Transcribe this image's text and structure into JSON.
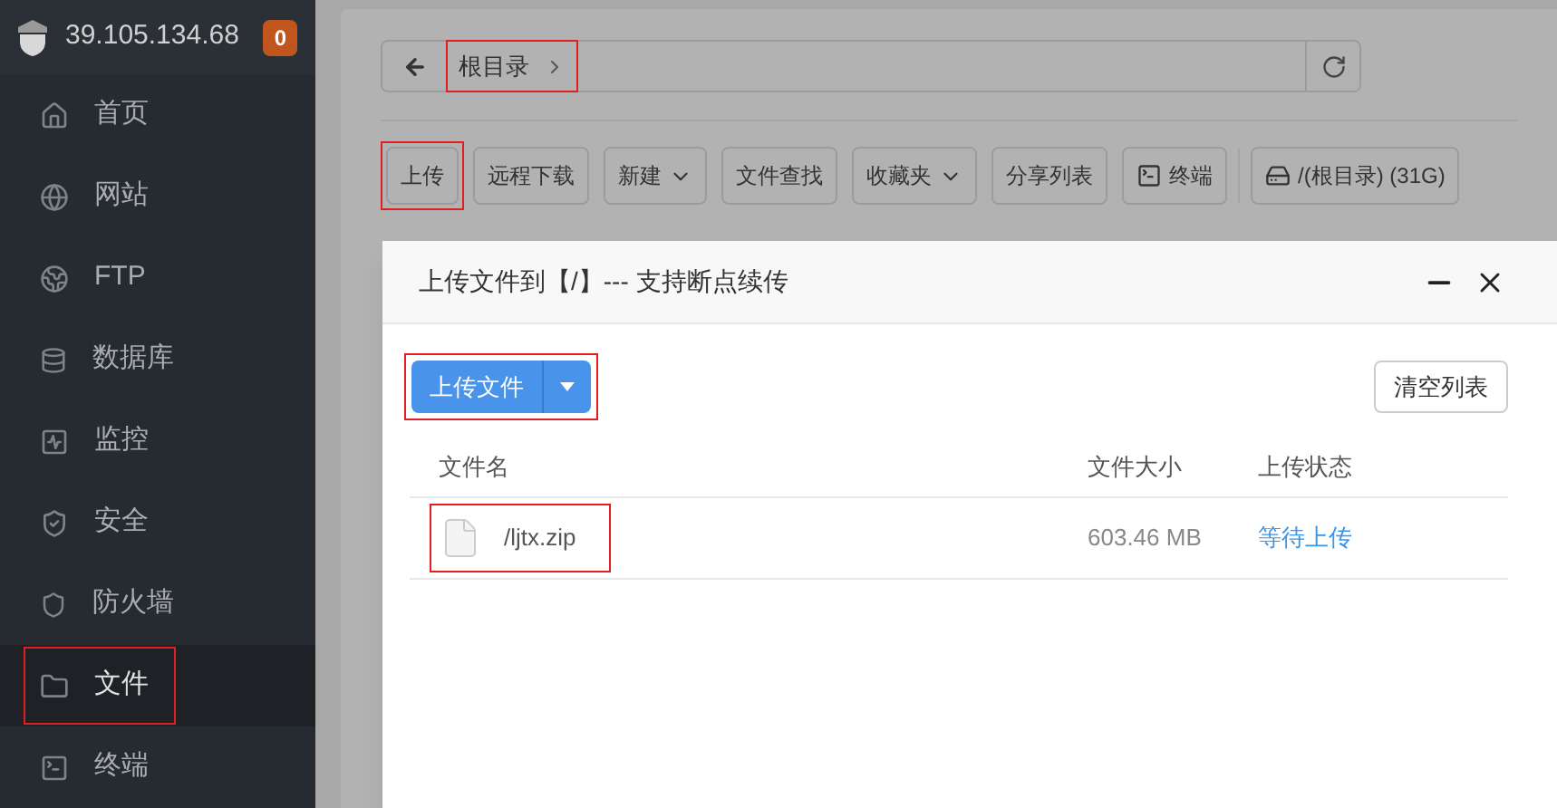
{
  "sidebar": {
    "server": "39.105.134.68",
    "badge": "0",
    "items": [
      {
        "label": "首页",
        "selected": false,
        "highlighted": false
      },
      {
        "label": "网站",
        "selected": false,
        "highlighted": false
      },
      {
        "label": "FTP",
        "selected": false,
        "highlighted": false
      },
      {
        "label": "数据库",
        "selected": false,
        "highlighted": false
      },
      {
        "label": "监控",
        "selected": false,
        "highlighted": false
      },
      {
        "label": "安全",
        "selected": false,
        "highlighted": false
      },
      {
        "label": "防火墙",
        "selected": false,
        "highlighted": false
      },
      {
        "label": "文件",
        "selected": true,
        "highlighted": true
      },
      {
        "label": "终端",
        "selected": false,
        "highlighted": false
      }
    ]
  },
  "path_bar": {
    "crumb": "根目录",
    "highlighted": true
  },
  "toolbar": [
    {
      "label": "上传",
      "kind": "plain",
      "highlighted": true
    },
    {
      "label": "远程下载",
      "kind": "plain",
      "highlighted": false
    },
    {
      "label": "新建",
      "kind": "dropdown",
      "highlighted": false
    },
    {
      "label": "文件查找",
      "kind": "plain",
      "highlighted": false
    },
    {
      "label": "收藏夹",
      "kind": "dropdown",
      "highlighted": false
    },
    {
      "label": "分享列表",
      "kind": "plain",
      "highlighted": false
    },
    {
      "label": "终端",
      "kind": "terminal",
      "highlighted": false
    },
    {
      "label": "/(根目录) (31G)",
      "kind": "disk",
      "highlighted": false
    }
  ],
  "dialog": {
    "title": "上传文件到【/】--- 支持断点续传",
    "upload_button": "上传文件",
    "upload_highlighted": true,
    "clear_button": "清空列表",
    "columns": [
      "文件名",
      "文件大小",
      "上传状态"
    ],
    "rows": [
      {
        "name": "/ljtx.zip",
        "size": "603.46 MB",
        "status": "等待上传",
        "highlighted": true
      }
    ]
  }
}
